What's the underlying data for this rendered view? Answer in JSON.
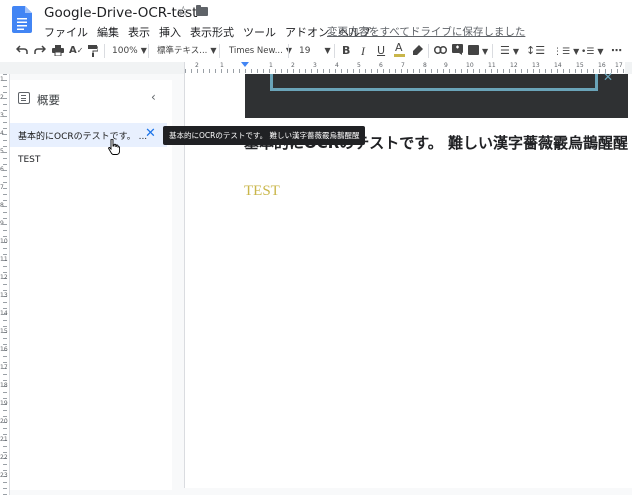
{
  "doc": {
    "title": "Google-Drive-OCR-test",
    "save_status": "変更内容をすべてドライブに保存しました"
  },
  "menu": [
    "ファイル",
    "編集",
    "表示",
    "挿入",
    "表示形式",
    "ツール",
    "アドオン",
    "ヘルプ"
  ],
  "toolbar": {
    "zoom": "100%",
    "style": "標準テキス...",
    "font": "Times New...",
    "font_size": "19",
    "icons": [
      "undo-icon",
      "redo-icon",
      "print-icon",
      "spellcheck-icon",
      "paint-format-icon",
      "bold-icon",
      "italic-icon",
      "underline-icon",
      "text-color-icon",
      "highlight-icon",
      "link-icon",
      "comment-icon",
      "image-icon",
      "align-icon",
      "line-spacing-icon",
      "numbered-list-icon",
      "bulleted-list-icon",
      "more-icon"
    ],
    "accent": "#1a73e8"
  },
  "ruler": {
    "h_numbers": [
      "2",
      "1",
      "1",
      "2",
      "3",
      "4",
      "5",
      "6",
      "7",
      "8",
      "9",
      "10",
      "11",
      "12",
      "13",
      "14",
      "15",
      "16",
      "17",
      "18"
    ],
    "v_numbers": [
      "1",
      "2",
      "3",
      "4",
      "5",
      "6",
      "7",
      "8",
      "9",
      "10",
      "11",
      "12",
      "13",
      "14",
      "15",
      "16",
      "17",
      "18",
      "19",
      "20",
      "21",
      "22",
      "23"
    ]
  },
  "outline": {
    "title": "概要",
    "items": [
      {
        "label": "基本的にOCRのテストです。 ..."
      },
      {
        "label": "TEST"
      }
    ],
    "tooltip": "基本的にOCRのテストです。 難しい漢字薔薇霰烏鵲醒醒"
  },
  "document": {
    "heading_1": "基本的にOCRのテストです。 難しい漢字薔薇霰烏鵲醒醒",
    "heading_2": "TEST",
    "heading_2_color": "#c9b64a"
  }
}
